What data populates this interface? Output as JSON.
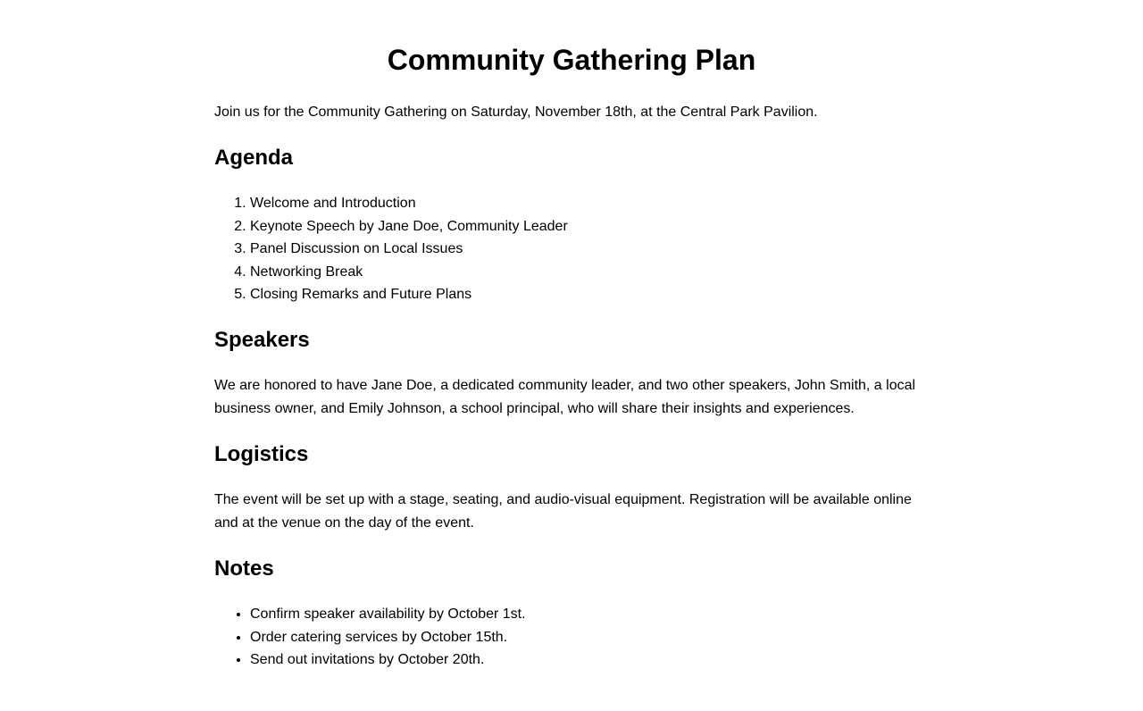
{
  "document": {
    "title": "Community Gathering Plan",
    "intro": "Join us for the Community Gathering on Saturday, November 18th, at the Central Park Pavilion."
  },
  "agenda": {
    "heading": "Agenda",
    "items": [
      "Welcome and Introduction",
      "Keynote Speech by Jane Doe, Community Leader",
      "Panel Discussion on Local Issues",
      "Networking Break",
      "Closing Remarks and Future Plans"
    ]
  },
  "speakers": {
    "heading": "Speakers",
    "text": "We are honored to have Jane Doe, a dedicated community leader, and two other speakers, John Smith, a local business owner, and Emily Johnson, a school principal, who will share their insights and experiences."
  },
  "logistics": {
    "heading": "Logistics",
    "text": "The event will be set up with a stage, seating, and audio-visual equipment. Registration will be available online and at the venue on the day of the event."
  },
  "notes": {
    "heading": "Notes",
    "items": [
      "Confirm speaker availability by October 1st.",
      "Order catering services by October 15th.",
      "Send out invitations by October 20th."
    ]
  }
}
